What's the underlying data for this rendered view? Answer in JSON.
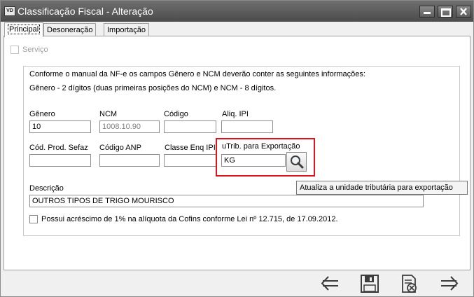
{
  "window": {
    "icon_text": "VD",
    "title": "Classificação Fiscal - Alteração"
  },
  "tabs": [
    {
      "label": "Principal"
    },
    {
      "label": "Desoneração"
    },
    {
      "label": "Importação"
    }
  ],
  "servico": {
    "label": "Serviço",
    "checked": false,
    "enabled": false
  },
  "info": {
    "line1": "Conforme o manual da NF-e os campos Gênero e NCM deverão conter as seguintes informações:",
    "line2": "Gênero - 2 dígitos (duas primeiras posições do NCM) e NCM - 8 dígitos."
  },
  "fields": {
    "genero": {
      "label": "Gênero",
      "value": "10"
    },
    "ncm": {
      "label": "NCM",
      "value": "1008.10.90"
    },
    "codigo": {
      "label": "Código",
      "value": ""
    },
    "aliq_ipi": {
      "label": "Aliq. IPI",
      "value": ""
    },
    "cod_prod_sefaz": {
      "label": "Cód. Prod. Sefaz",
      "value": ""
    },
    "codigo_anp": {
      "label": "Código ANP",
      "value": ""
    },
    "classe_enq_ipi": {
      "label": "Classe Enq IPI",
      "value": ""
    },
    "utrib": {
      "label": "uTrib. para Exportação",
      "value": "KG"
    },
    "descricao": {
      "label": "Descrição",
      "value": "OUTROS TIPOS DE TRIGO MOURISCO"
    }
  },
  "tooltip": "Atualiza a unidade tributária para exportação",
  "cofins": {
    "label": "Possui acréscimo de 1% na alíquota da Cofins conforme Lei nº 12.715, de 17.09.2012.",
    "checked": false
  },
  "colors": {
    "highlight": "#e0141e",
    "titlebar": "#5a5a5a"
  }
}
